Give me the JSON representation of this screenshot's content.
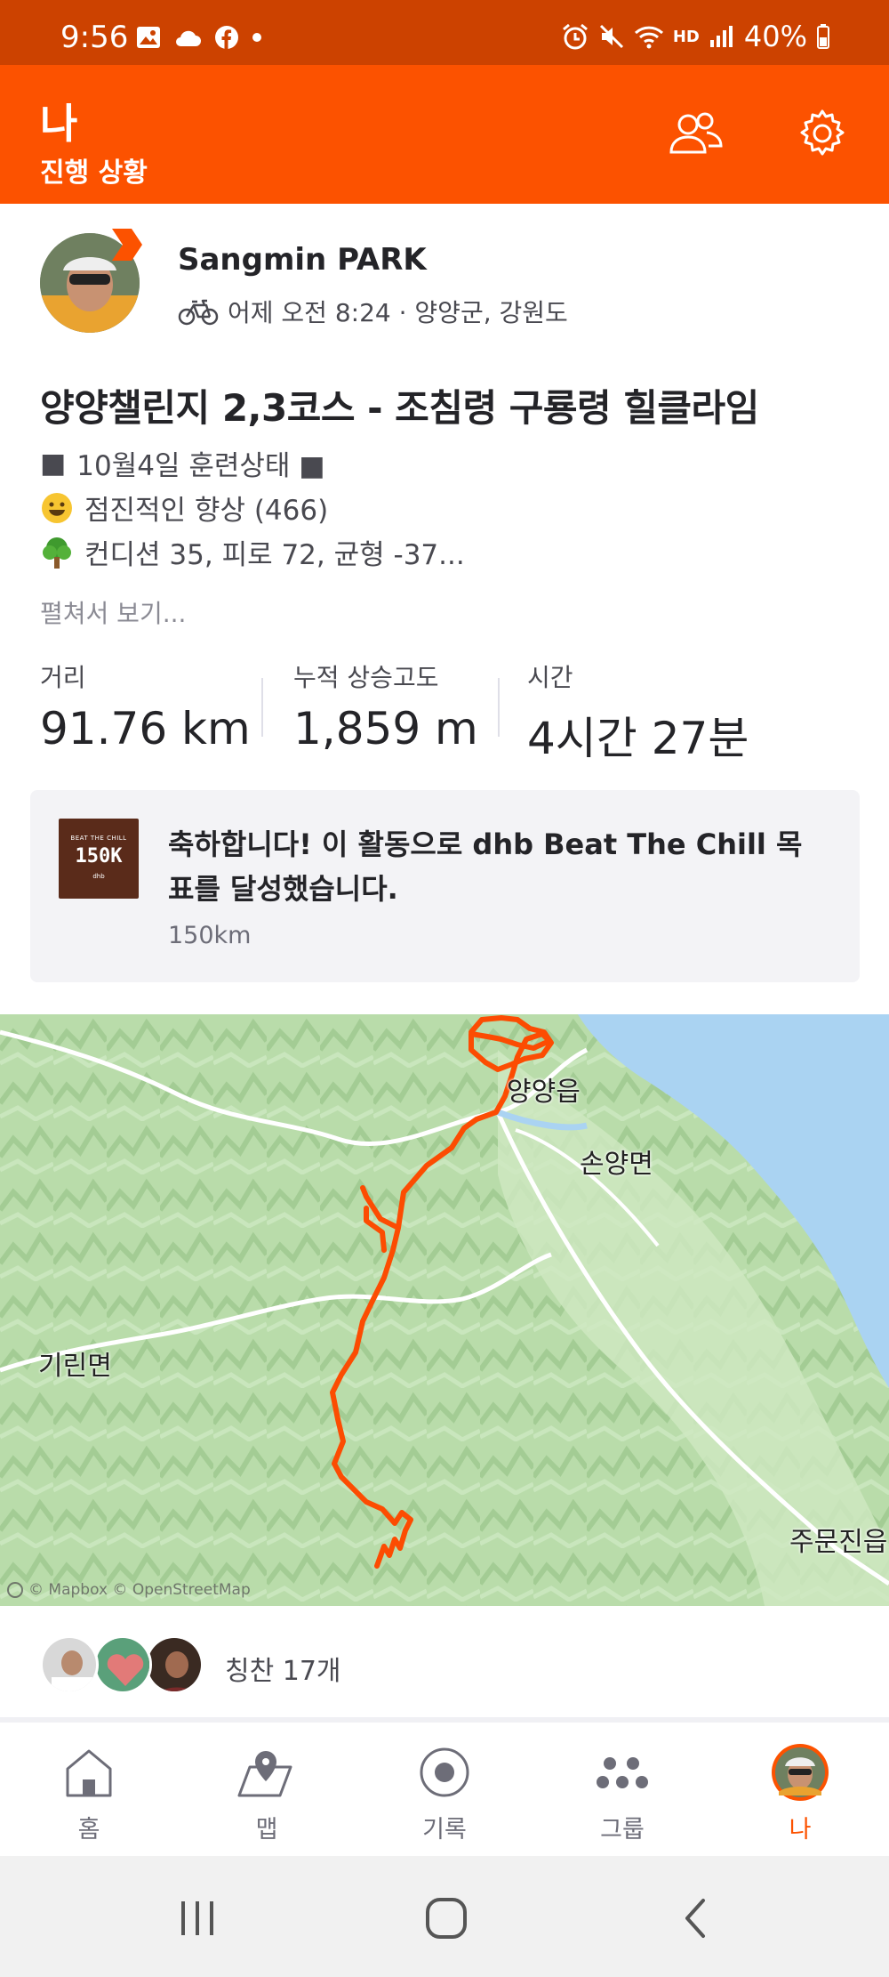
{
  "status_bar": {
    "time": "9:56",
    "battery": "40%",
    "hd_label": "HD"
  },
  "header": {
    "title": "나",
    "subtitle": "진행 상황"
  },
  "activity": {
    "athlete_name": "Sangmin PARK",
    "meta": "어제 오전 8:24 · 양양군, 강원도",
    "title": "양양챌린지 2,3코스 - 조침령 구룡령 힐클라임",
    "description_lines": [
      {
        "emoji": "■",
        "text": "10월4일 훈련상태 ■"
      },
      {
        "emoji": "😀",
        "text": "점진적인 향상 (466)"
      },
      {
        "emoji": "🌳",
        "text": "컨디션 35, 피로 72, 균형 -37..."
      }
    ],
    "see_more": "펼쳐서 보기...",
    "stats": [
      {
        "label": "거리",
        "value": "91.76 km"
      },
      {
        "label": "누적 상승고도",
        "value": "1,859 m"
      },
      {
        "label": "시간",
        "value": "4시간 27분"
      }
    ]
  },
  "challenge": {
    "badge_line1": "BEAT THE CHILL",
    "badge_line2": "150K",
    "badge_line3": "dhb",
    "message": "축하합니다! 이 활동으로 dhb Beat The Chill 목표를 달성했습니다.",
    "sub": "150km"
  },
  "map": {
    "labels": [
      "양양읍",
      "손양면",
      "기린면",
      "주문진읍"
    ],
    "attribution": "© Mapbox © OpenStreetMap",
    "route_color": "#fc4c02",
    "water_color": "#aad3f2"
  },
  "kudos": {
    "text": "칭찬 17개"
  },
  "bottom_nav": {
    "items": [
      {
        "label": "홈",
        "icon": "home-icon"
      },
      {
        "label": "맵",
        "icon": "map-pin-icon"
      },
      {
        "label": "기록",
        "icon": "record-icon"
      },
      {
        "label": "그룹",
        "icon": "groups-icon"
      },
      {
        "label": "나",
        "icon": "profile-avatar"
      }
    ],
    "active": "나"
  },
  "colors": {
    "brand": "#fc5200",
    "status_bar": "#cc4200"
  }
}
